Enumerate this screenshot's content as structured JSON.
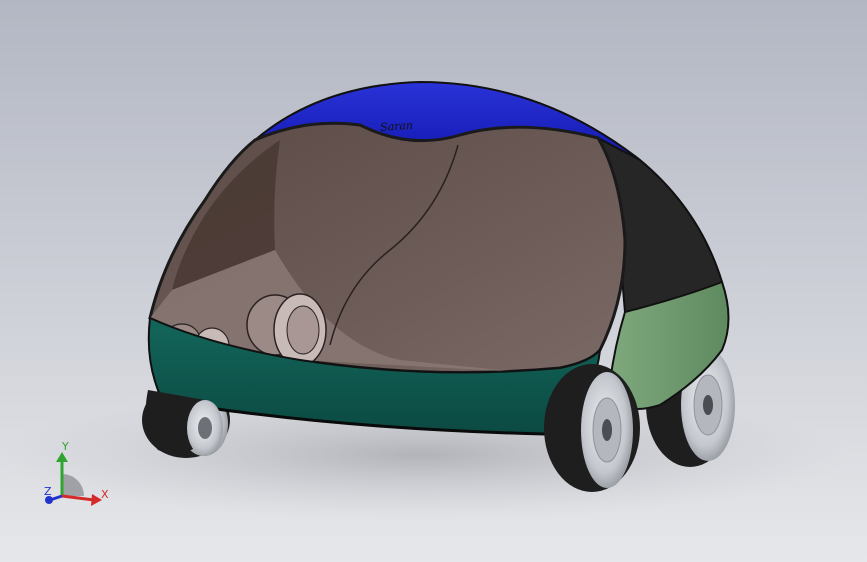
{
  "app": {
    "kind": "3d-cad-viewport"
  },
  "model": {
    "roof_emblem": "Saran",
    "colors": {
      "background_top": "#b3b7c3",
      "background_bottom": "#e6e7ea",
      "roof": "#1a22c4",
      "rear_glass": "#262626",
      "side_panel": "#6f9a6f",
      "skirt": "#0f5a50",
      "interior": "#6b5a56",
      "tire": "#1e1e1e",
      "rim": "#c9cdd3"
    }
  },
  "triad": {
    "x_label": "X",
    "y_label": "Y",
    "z_label": "Z",
    "colors": {
      "x": "#d42a2a",
      "y": "#2fa52f",
      "z": "#2233cc"
    }
  }
}
